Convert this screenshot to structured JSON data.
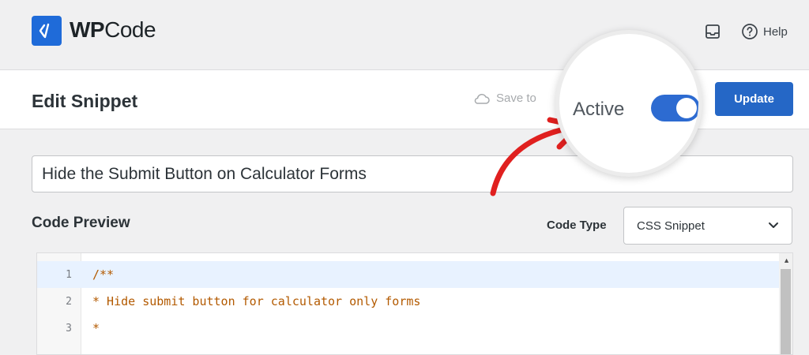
{
  "brand": {
    "name_bold": "WP",
    "name_regular": "Code",
    "color": "#1f6bd9"
  },
  "topbar": {
    "help_label": "Help",
    "icons": [
      "inbox-icon",
      "help-circle-icon"
    ]
  },
  "header": {
    "title": "Edit Snippet",
    "save_label": "Save to",
    "update_label": "Update",
    "active_label": "Active",
    "active_state": true,
    "accent": "#2567c6"
  },
  "snippet": {
    "title_value": "Hide the Submit Button on Calculator Forms",
    "code_preview_label": "Code Preview",
    "code_type_label": "Code Type",
    "code_type_value": "CSS Snippet"
  },
  "editor": {
    "lines": [
      {
        "number": "1",
        "text": "/**"
      },
      {
        "number": "2",
        "text": "* Hide submit button for calculator only forms"
      },
      {
        "number": "3",
        "text": "*"
      }
    ],
    "code_color": "#b35a00",
    "highlight_color": "#e8f2ff"
  },
  "annotation": {
    "arrow_color": "#e0201f"
  }
}
